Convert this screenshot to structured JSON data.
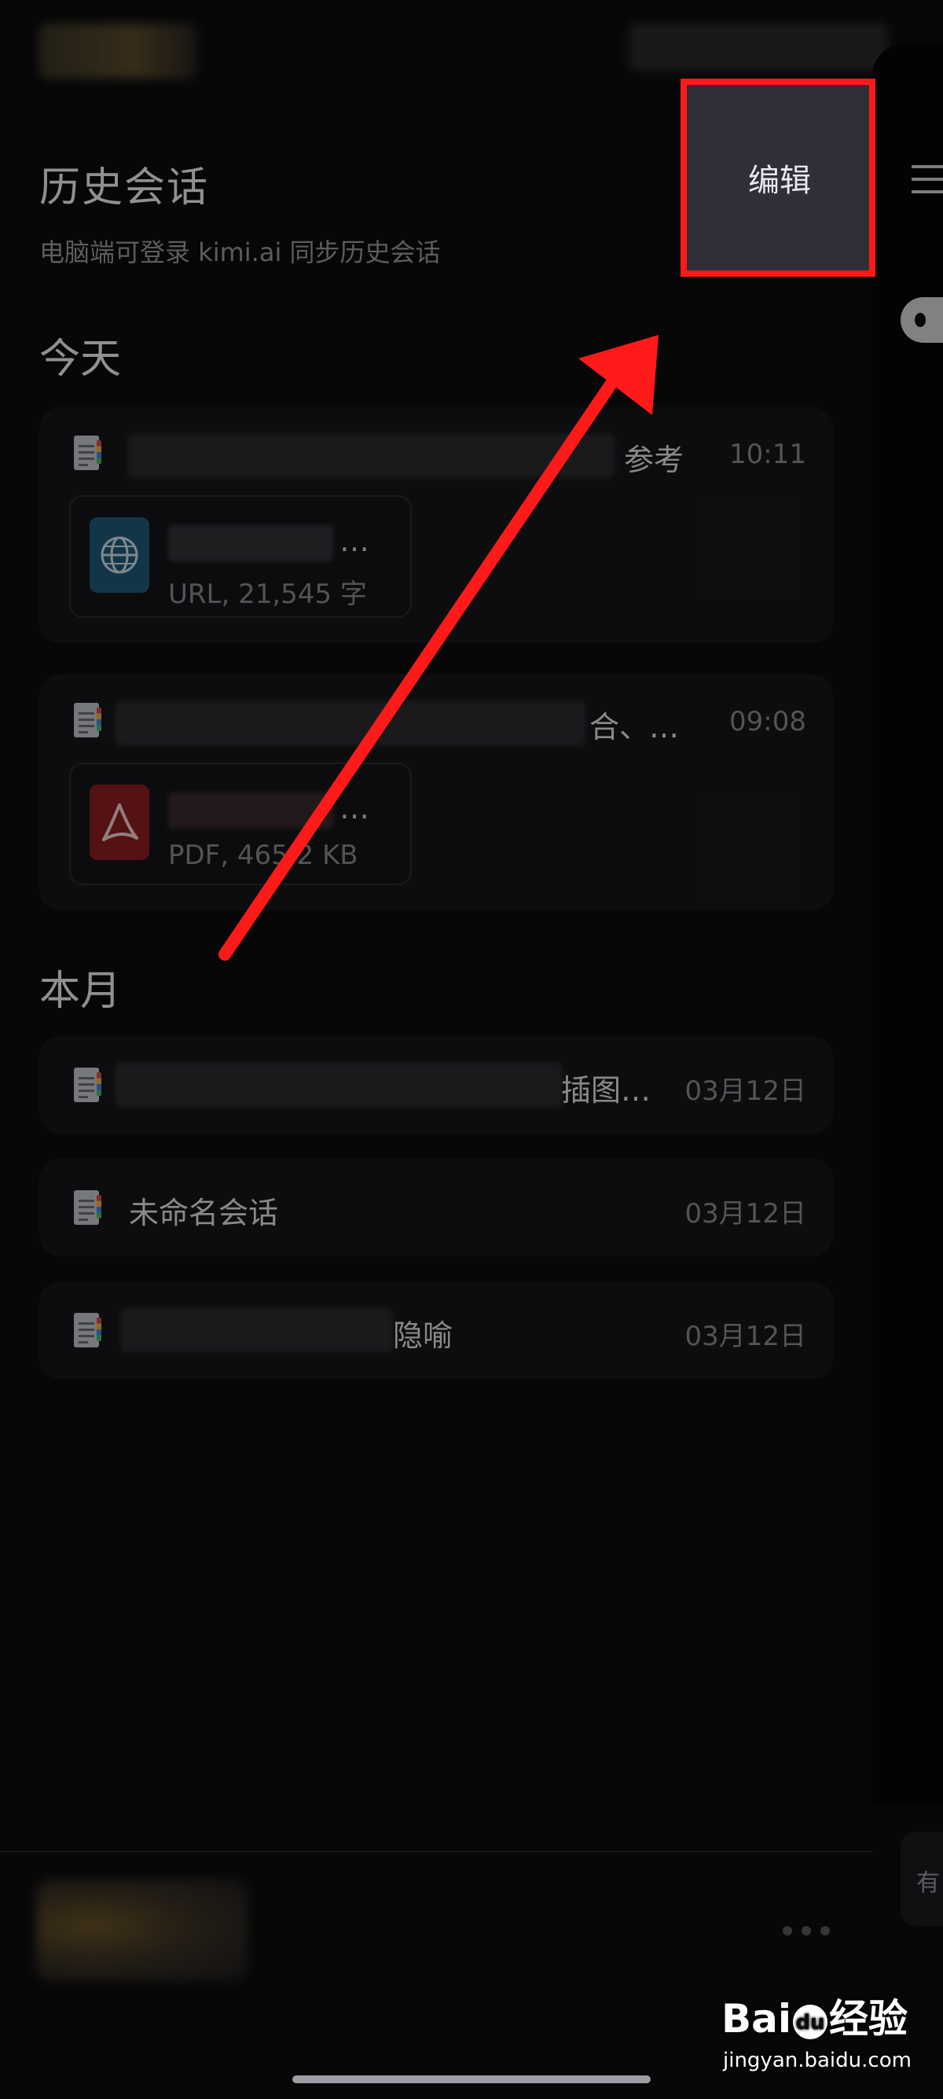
{
  "header": {
    "title": "历史会话",
    "subtitle": "电脑端可登录 kimi.ai  同步历史会话",
    "edit_label": "编辑"
  },
  "sections": {
    "today": "今天",
    "month": "本月"
  },
  "conversations": [
    {
      "suffix": "参考",
      "time": "10:11",
      "attachment": {
        "type": "url",
        "icon": "globe-icon",
        "meta": "URL, 21,545 字"
      }
    },
    {
      "suffix": "合、…",
      "time": "09:08",
      "attachment": {
        "type": "pdf",
        "icon": "pdf-icon",
        "meta": "PDF, 465.2 KB"
      }
    },
    {
      "suffix": "插图…",
      "time": "03月12日"
    },
    {
      "title": "未命名会话",
      "time": "03月12日"
    },
    {
      "suffix": "隐喻",
      "time": "03月12日"
    }
  ],
  "attachment_name_ellipsis": "…",
  "right_panel": {
    "partial_label": "有"
  },
  "watermark": {
    "logo_a": "Bai",
    "logo_b": "du",
    "logo_c": "经验",
    "url": "jingyan.baidu.com"
  },
  "colors": {
    "highlight": "#ff1a1a",
    "arrow": "#ff1a1a",
    "background": "#0c0c0e",
    "edit_button": "#2f2f38"
  }
}
